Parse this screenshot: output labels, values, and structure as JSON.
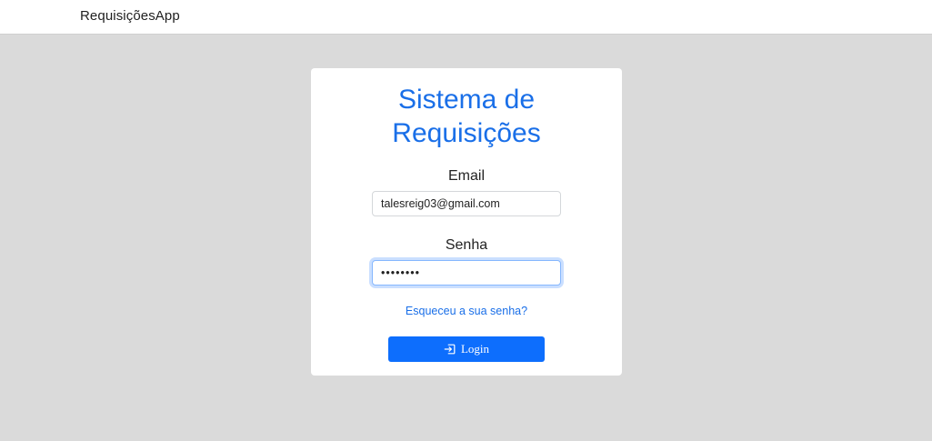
{
  "navbar": {
    "brand": "RequisiçõesApp"
  },
  "login": {
    "title_line1": "Sistema de",
    "title_line2": "Requisições",
    "email_label": "Email",
    "email_value": "talesreig03@gmail.com",
    "password_label": "Senha",
    "password_value": "12345678",
    "forgot_link": "Esqueceu a sua senha?",
    "login_button": "Login",
    "login_icon": "box-arrow-in-right-icon"
  },
  "colors": {
    "background": "#dadada",
    "accent": "#0d6efd",
    "title": "#1a6fe8"
  }
}
